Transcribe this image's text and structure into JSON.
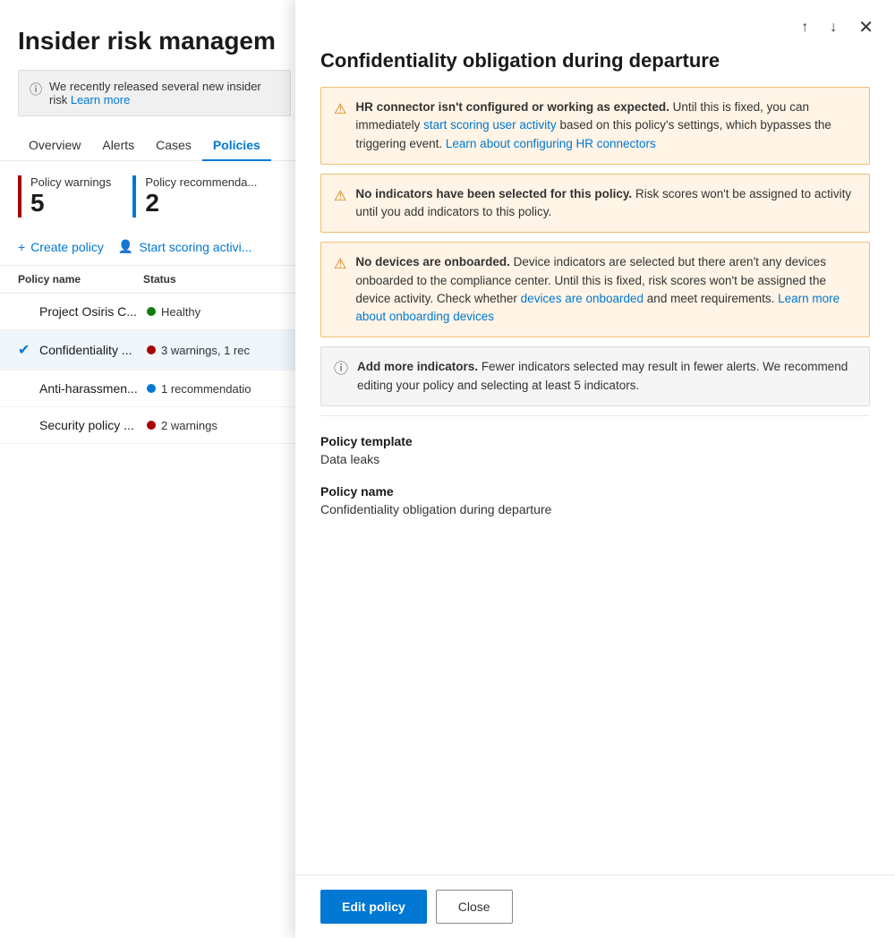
{
  "bgPage": {
    "title": "Insider risk managem",
    "banner": {
      "text": "We recently released several new insider risk",
      "linkText": "Learn more"
    },
    "tabs": [
      {
        "label": "Overview",
        "active": false
      },
      {
        "label": "Alerts",
        "active": false
      },
      {
        "label": "Cases",
        "active": false
      },
      {
        "label": "Policies",
        "active": true
      }
    ],
    "stats": [
      {
        "label": "Policy warnings",
        "value": "5",
        "color": "red"
      },
      {
        "label": "Policy recommenda...",
        "value": "2",
        "color": "blue"
      }
    ],
    "actions": [
      {
        "label": "Create policy",
        "icon": "+"
      },
      {
        "label": "Start scoring activi...",
        "icon": "👤"
      }
    ],
    "tableHeaders": [
      "Policy name",
      "Status"
    ],
    "policies": [
      {
        "name": "Project Osiris C...",
        "statusDot": "green",
        "statusText": "Healthy",
        "selected": false,
        "checked": false
      },
      {
        "name": "Confidentiality ...",
        "statusDot": "red",
        "statusText": "3 warnings, 1 rec",
        "selected": true,
        "checked": true
      },
      {
        "name": "Anti-harassmen...",
        "statusDot": "blue",
        "statusText": "1 recommendatio",
        "selected": false,
        "checked": false
      },
      {
        "name": "Security policy ...",
        "statusDot": "red",
        "statusText": "2 warnings",
        "selected": false,
        "checked": false
      }
    ]
  },
  "panel": {
    "title": "Confidentiality obligation during departure",
    "navUpLabel": "↑",
    "navDownLabel": "↓",
    "closeLabel": "✕",
    "alerts": [
      {
        "type": "warning",
        "icon": "⚠",
        "boldText": "HR connector isn't configured or working as expected.",
        "text": " Until this is fixed, you can immediately ",
        "linkText1": "start scoring user activity",
        "midText": " based on this policy's settings, which bypasses the triggering event. ",
        "linkText2": "Learn about configuring HR connectors",
        "afterText": ""
      },
      {
        "type": "warning",
        "icon": "⚠",
        "boldText": "No indicators have been selected for this policy.",
        "text": " Risk scores won't be assigned to activity until you add indicators to this policy.",
        "linkText1": "",
        "midText": "",
        "linkText2": "",
        "afterText": ""
      },
      {
        "type": "warning",
        "icon": "⚠",
        "boldText": "No devices are onboarded.",
        "text": " Device indicators are selected but there aren't any devices onboarded to the compliance center. Until this is fixed, risk scores won't be assigned the device activity. Check whether ",
        "linkText1": "devices are onboarded",
        "midText": " and meet requirements. ",
        "linkText2": "Learn more about onboarding devices",
        "afterText": ""
      },
      {
        "type": "info",
        "icon": "ℹ",
        "boldText": "Add more indicators.",
        "text": " Fewer indicators selected may result in fewer alerts. We recommend editing your policy and selecting at least 5 indicators.",
        "linkText1": "",
        "midText": "",
        "linkText2": "",
        "afterText": ""
      }
    ],
    "policyTemplateLabel": "Policy template",
    "policyTemplateValue": "Data leaks",
    "policyNameLabel": "Policy name",
    "policyNameValue": "Confidentiality obligation during departure",
    "footer": {
      "editLabel": "Edit policy",
      "closeLabel": "Close"
    }
  }
}
